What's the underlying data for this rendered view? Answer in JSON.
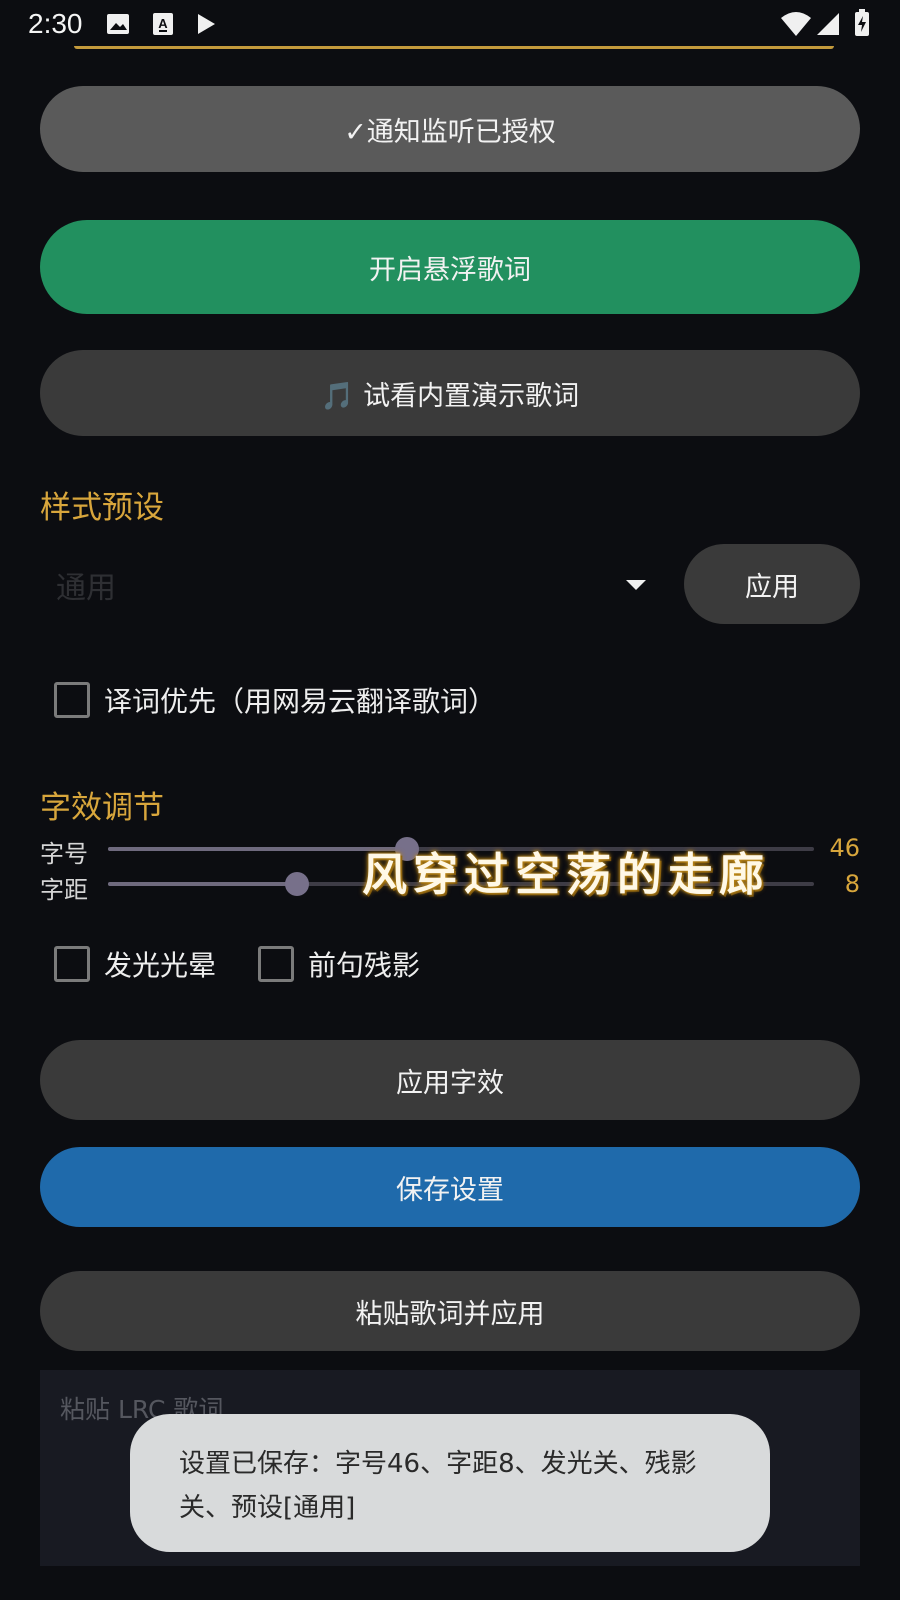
{
  "status_bar": {
    "time": "2:30",
    "icons": [
      "image-icon",
      "a-text-icon",
      "play-icon",
      "wifi-icon",
      "signal-icon",
      "battery-charging-icon"
    ]
  },
  "buttons": {
    "notify_label": "✓通知监听已授权",
    "float_label": "开启悬浮歌词",
    "demo_label": "🎵 试看内置演示歌词",
    "apply_effect_label": "应用字效",
    "save_label": "保存设置",
    "paste_label": "粘贴歌词并应用"
  },
  "preset": {
    "title": "样式预设",
    "selected": "通用",
    "apply_label": "应用"
  },
  "translate_option": {
    "label": "译词优先（用网易云翻译歌词）",
    "checked": false
  },
  "effects": {
    "title": "字效调节",
    "font_size": {
      "label": "字号",
      "value": 46,
      "fraction": 0.423
    },
    "spacing": {
      "label": "字距",
      "value": 8,
      "fraction": 0.267
    },
    "glow": {
      "label": "发光光晕",
      "checked": false
    },
    "ghost": {
      "label": "前句残影",
      "checked": false
    }
  },
  "floating_lyric": "风穿过空荡的走廊",
  "lrc_input": {
    "placeholder": "粘贴 LRC 歌词…",
    "value": ""
  },
  "toast": "设置已保存：字号46、字距8、发光关、残影关、预设[通用]",
  "colors": {
    "accent": "#d8a63c",
    "green": "#22905f",
    "blue": "#1f6aab",
    "background": "#0c0d11"
  }
}
